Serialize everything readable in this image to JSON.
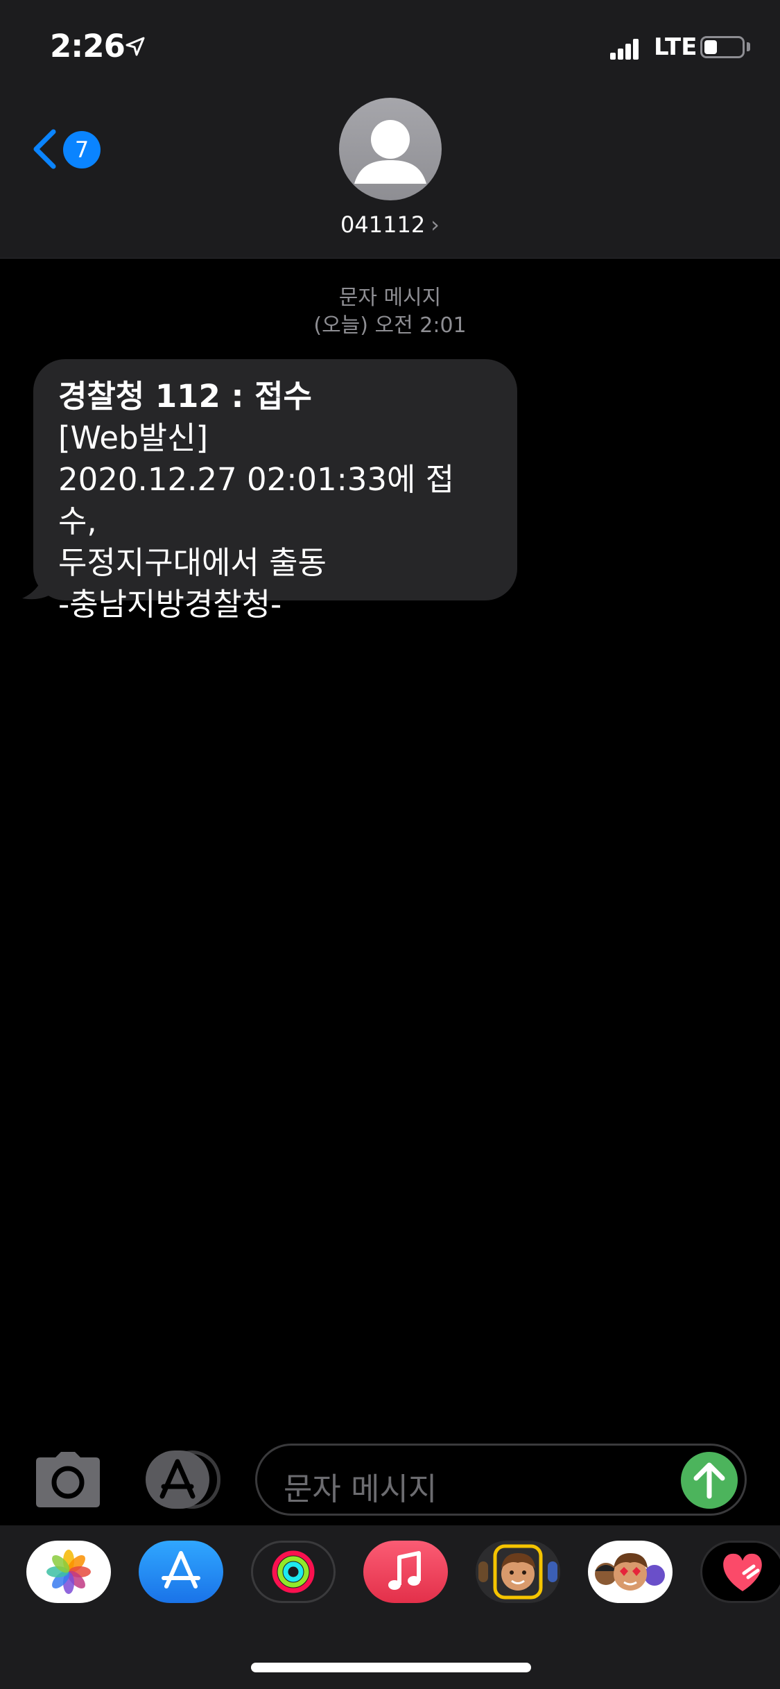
{
  "status_bar": {
    "time": "2:26",
    "network": "LTE",
    "battery_level": 0.35
  },
  "header": {
    "back_badge": "7",
    "contact_name": "041112",
    "chevron": "›"
  },
  "conversation": {
    "timestamp_line1": "문자 메시지",
    "timestamp_line2": "(오늘) 오전 2:01",
    "message": {
      "line1": "경찰청 112 : 접수",
      "line2": "[Web발신]",
      "line3": "2020.12.27 02:01:33에 접수,",
      "line4": "두정지구대에서 출동",
      "line5": "-충남지방경찰청-"
    }
  },
  "input_bar": {
    "placeholder": "문자 메시지"
  },
  "drawer": {
    "apps": [
      "photos-icon",
      "app-store-icon",
      "activity-icon",
      "music-icon",
      "memoji-icon",
      "animoji-stickers-icon",
      "digital-touch-icon"
    ]
  },
  "colors": {
    "accent": "#0a84ff",
    "send": "#4cb45c",
    "bubble": "#262628",
    "header": "#1c1c1e"
  }
}
